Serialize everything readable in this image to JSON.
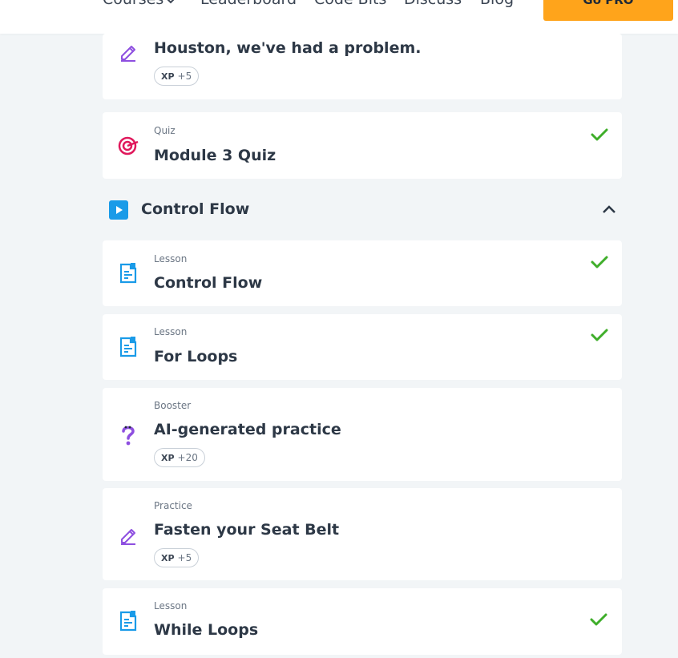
{
  "nav": {
    "courses": "Courses",
    "leaderboard": "Leaderboard",
    "code_bits": "Code Bits",
    "discuss": "Discuss",
    "blog": "Blog",
    "go_pro": "Go PRO"
  },
  "colors": {
    "accent_orange": "#ffa41b",
    "check_green": "#3fae2a",
    "practice_purple": "#8e4fe0",
    "quiz_pink": "#e0195c",
    "lesson_blue": "#1a9be8"
  },
  "items_top": [
    {
      "type": "",
      "title": "Houston, we've had a problem.",
      "xp_label": "XP",
      "xp_value": "+5",
      "icon": "pencil-icon",
      "completed": false
    },
    {
      "type": "Quiz",
      "title": "Module 3 Quiz",
      "icon": "target-icon",
      "completed": true
    }
  ],
  "section": {
    "title": "Control Flow",
    "expanded": true
  },
  "items": [
    {
      "type": "Lesson",
      "title": "Control Flow",
      "icon": "document-icon",
      "completed": true
    },
    {
      "type": "Lesson",
      "title": "For Loops",
      "icon": "document-icon",
      "completed": true
    },
    {
      "type": "Booster",
      "title": "AI-generated practice",
      "xp_label": "XP",
      "xp_value": "+20",
      "icon": "question-icon",
      "completed": false
    },
    {
      "type": "Practice",
      "title": "Fasten your Seat Belt",
      "xp_label": "XP",
      "xp_value": "+5",
      "icon": "pencil-icon",
      "completed": false
    },
    {
      "type": "Lesson",
      "title": "While Loops",
      "icon": "document-icon",
      "completed": true
    }
  ]
}
